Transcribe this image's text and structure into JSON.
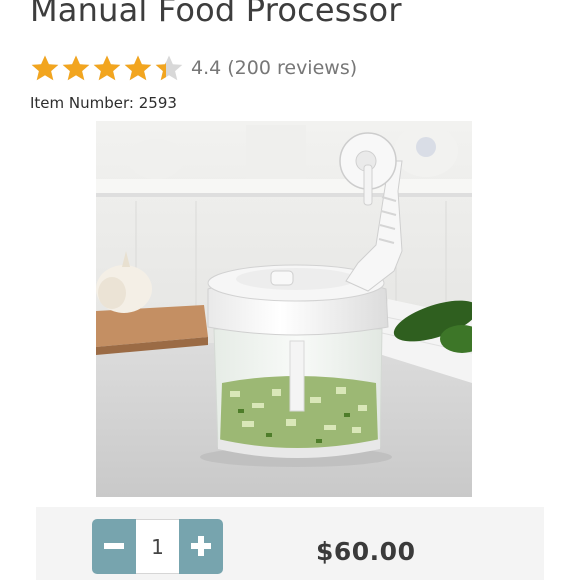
{
  "product": {
    "title": "Manual Food Processor",
    "rating": 4.4,
    "rating_display": "4.4",
    "reviews_text": "(200 reviews)",
    "item_number_label": "Item Number: 2593"
  },
  "stars": {
    "filled_color": "#f2a51f",
    "empty_color": "#d8d8d8",
    "count": 5
  },
  "cart": {
    "quantity": "1",
    "minus_icon": "minus-icon",
    "plus_icon": "plus-icon",
    "price": "$60.00",
    "accent_color": "#77a4ae"
  }
}
